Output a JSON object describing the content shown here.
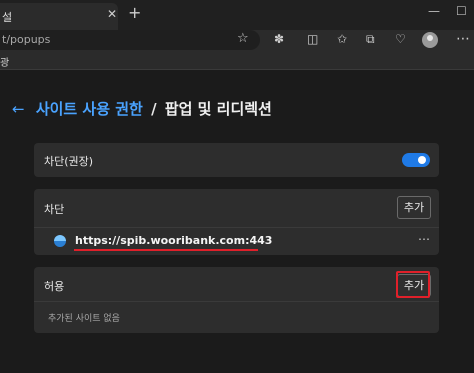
{
  "browser": {
    "tab_title": "설",
    "tab_close_icon": "close-icon",
    "new_tab_icon": "plus-icon",
    "minimize_icon": "minimize-icon",
    "maximize_icon": "maximize-icon",
    "address": "t/popups",
    "favorites_bar_text": "광"
  },
  "header": {
    "back_icon": "back-arrow-icon",
    "crumb_parent": "사이트 사용 권한",
    "crumb_separator": "/",
    "crumb_current": "팝업 및 리디렉션"
  },
  "block_toggle": {
    "label": "차단(권장)",
    "enabled": true,
    "accent": "#1f7ae6"
  },
  "block_section": {
    "label": "차단",
    "add_button": "추가",
    "sites": [
      {
        "url": "https://spib.wooribank.com:443",
        "more_icon": "more-icon"
      }
    ]
  },
  "allow_section": {
    "label": "허용",
    "add_button": "추가",
    "empty_text": "추가된 사이트 없음"
  },
  "colors": {
    "accent": "#4aa3ff",
    "highlight": "#e0202a"
  }
}
